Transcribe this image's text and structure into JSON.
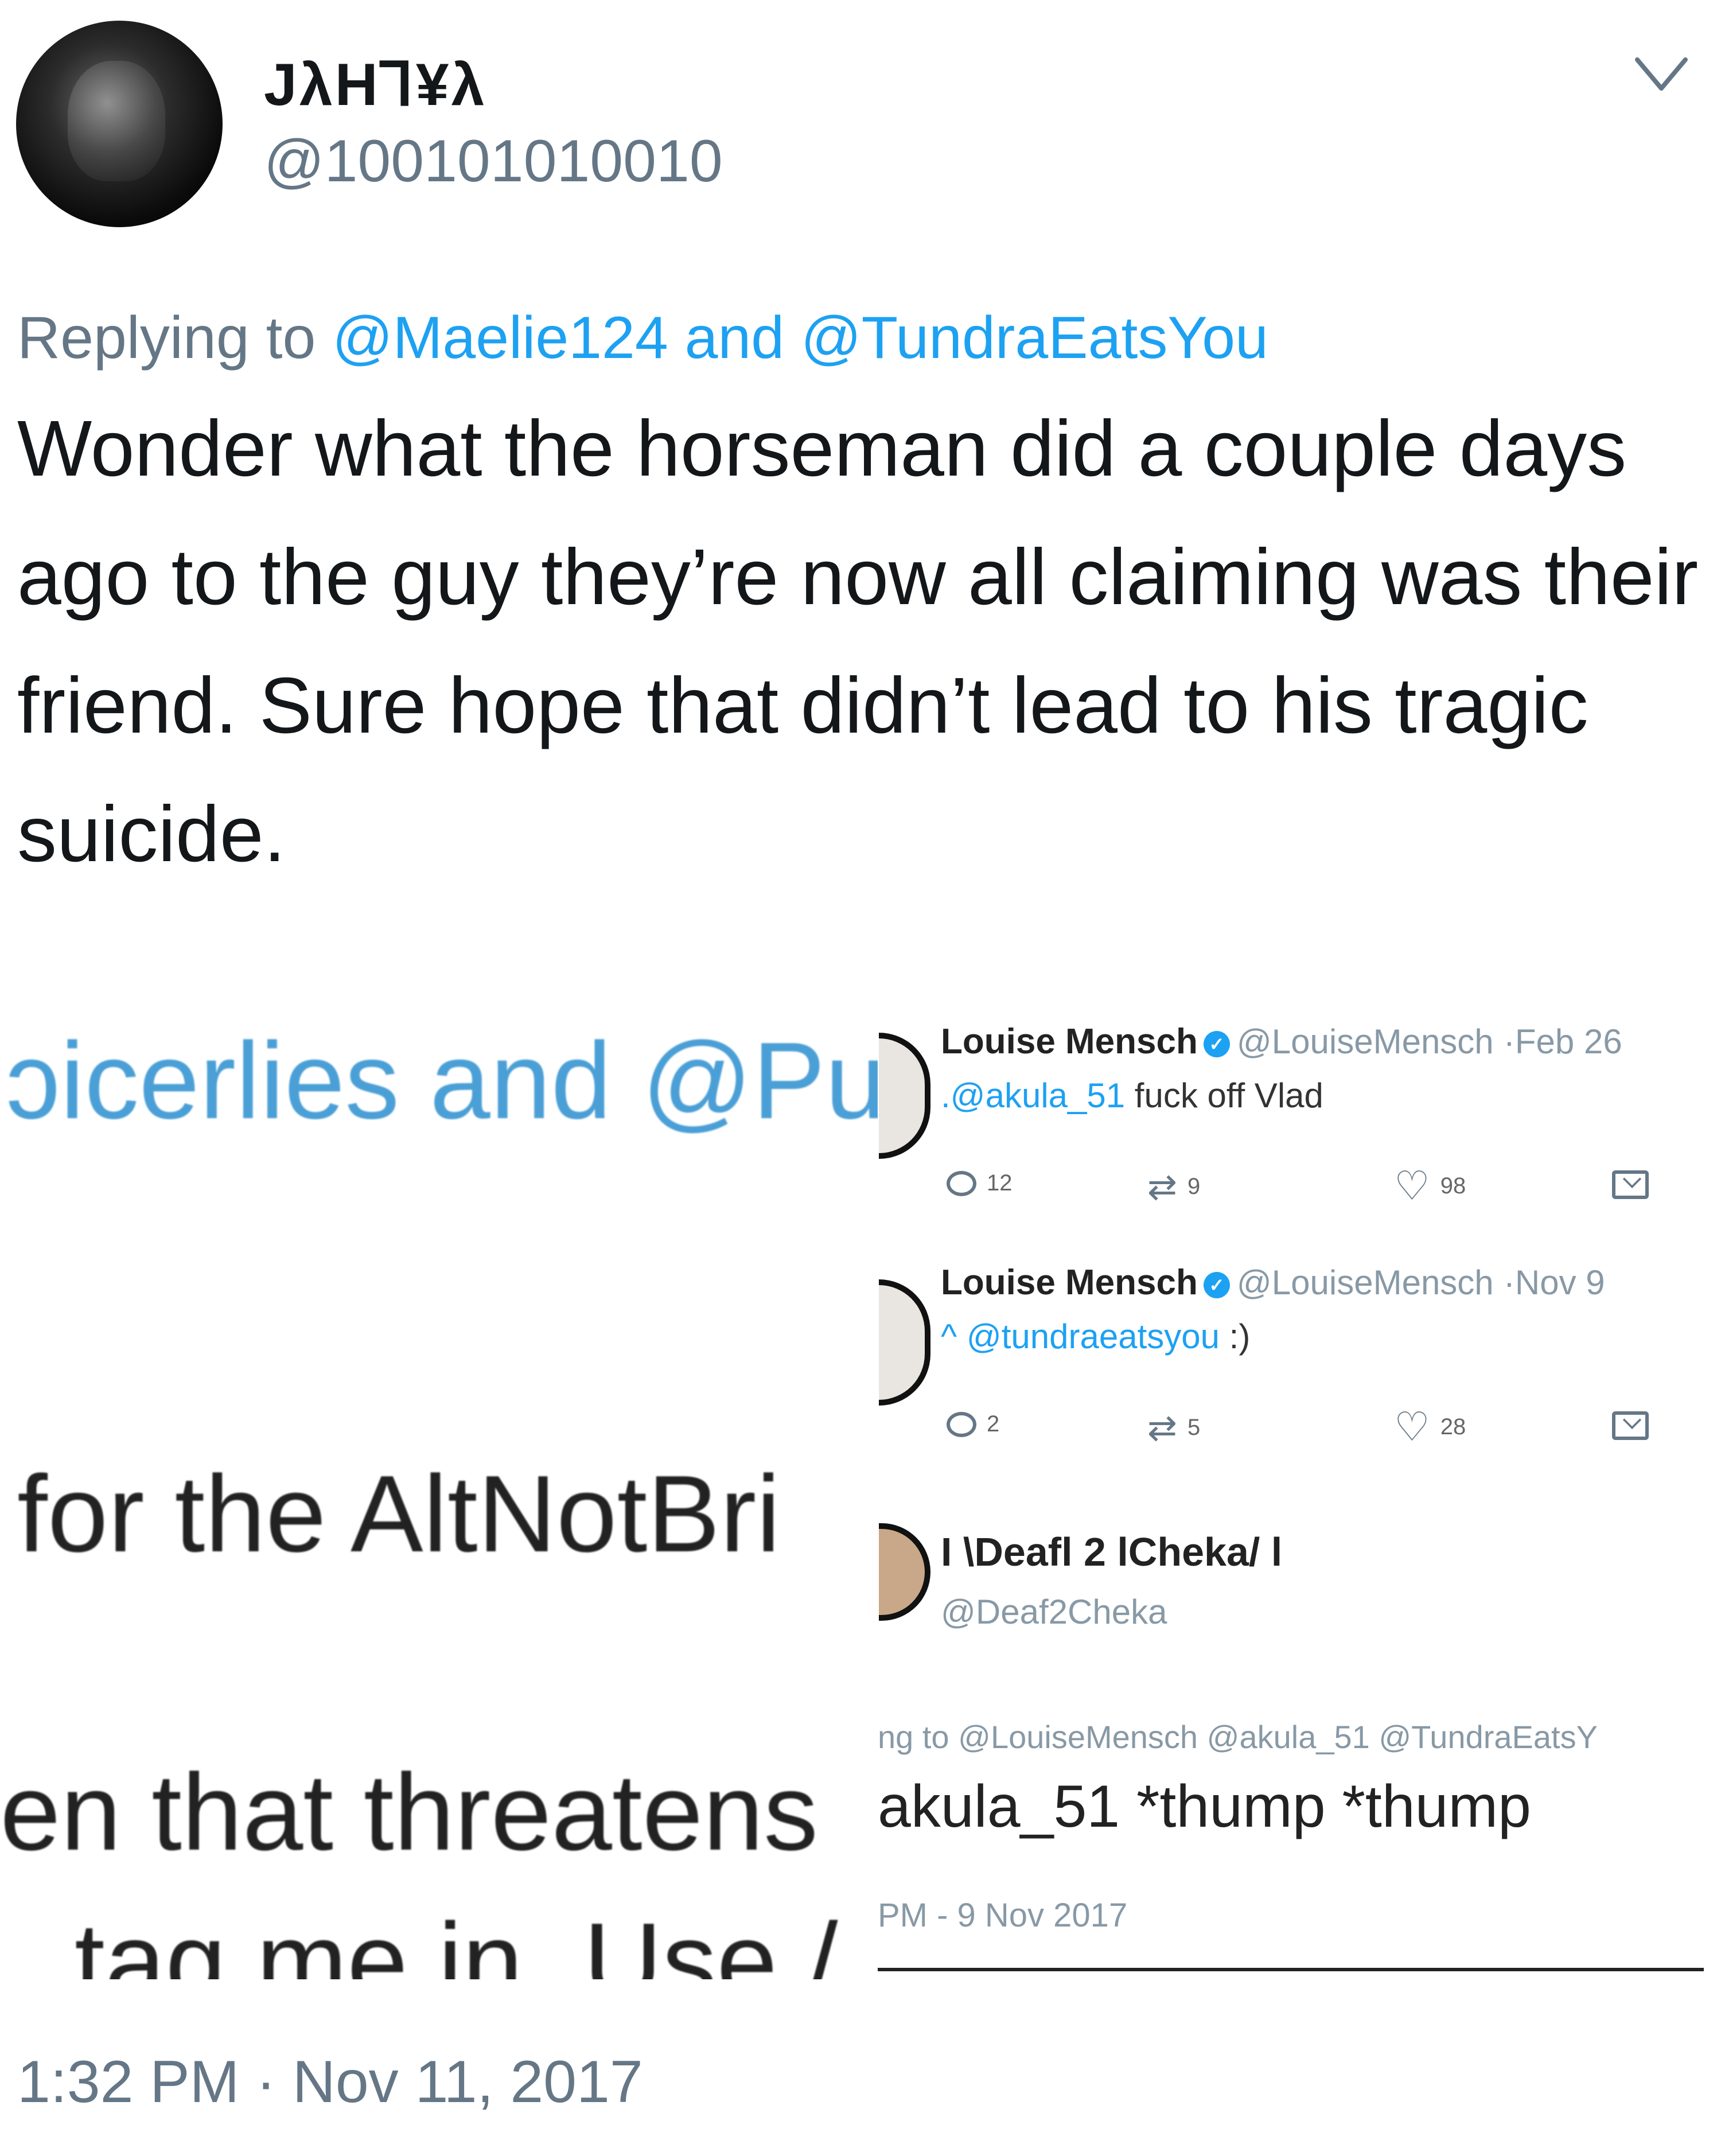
{
  "tweet": {
    "display_name": "JλH⅂¥λ",
    "handle": "@100101010010",
    "reply_prefix": "Replying to",
    "reply_mention_1": "@Maelie124",
    "reply_and": "and",
    "reply_mention_2": "@TundraEatsYou",
    "text": "Wonder what the horseman did a couple days ago to the guy they’re now all claiming was their friend. Sure hope that didn’t lead to his tragic suicide.",
    "timestamp": "1:32 PM · Nov 11, 2017"
  },
  "embedded_image": {
    "left_fragments": [
      "ɔicerlies and @Pu",
      "for the AltNotBri",
      "en that threatens",
      "tag me in. Use /"
    ],
    "tweets": [
      {
        "name": "Louise Mensch",
        "handle": "@LouiseMensch",
        "date": "·Feb 26",
        "mention": ".@akula_51",
        "text": " fuck off Vlad",
        "replies": "12",
        "retweets": "9",
        "likes": "98"
      },
      {
        "name": "Louise Mensch",
        "handle": "@LouiseMensch",
        "date": "·Nov 9",
        "mention": "^ @tundraeatsyou",
        "text": " :)",
        "replies": "2",
        "retweets": "5",
        "likes": "28"
      }
    ],
    "third": {
      "name": "I \\Deafl 2 lCheka/ l",
      "handle": "@Deaf2Cheka",
      "reply_line": "ng to @LouiseMensch @akula_51 @TundraEatsY",
      "text": "akula_51 *thump *thump",
      "time": "PM - 9 Nov 2017"
    }
  },
  "icons": {
    "chevron": "chevron-down-icon",
    "reply": "reply-icon",
    "retweet": "retweet-icon",
    "like": "heart-icon",
    "dm": "message-icon"
  },
  "colors": {
    "link": "#1da1f2",
    "muted": "#657786"
  }
}
